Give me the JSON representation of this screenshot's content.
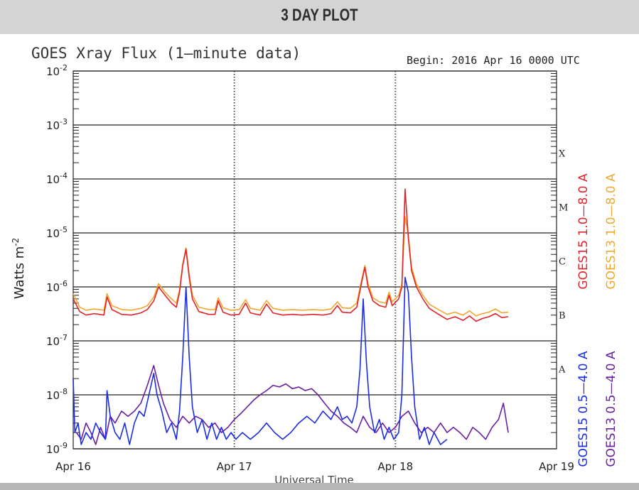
{
  "header": {
    "title": "3 DAY PLOT"
  },
  "chart_data": {
    "type": "line",
    "title": "GOES Xray Flux (1—minute data)",
    "subtitle": "Begin:  2016 Apr 16 0000 UTC",
    "ylabel": "Watts m",
    "ylabel_sup": "-2",
    "xlabel": "Universal Time",
    "y_scale": "log",
    "ylim": [
      1e-09,
      0.01
    ],
    "xlim": [
      0,
      3
    ],
    "y_ticks": [
      {
        "value": 0.01,
        "exp": "-2"
      },
      {
        "value": 0.001,
        "exp": "-3"
      },
      {
        "value": 0.0001,
        "exp": "-4"
      },
      {
        "value": 1e-05,
        "exp": "-5"
      },
      {
        "value": 1e-06,
        "exp": "-6"
      },
      {
        "value": 1e-07,
        "exp": "-7"
      },
      {
        "value": 1e-08,
        "exp": "-8"
      },
      {
        "value": 1e-09,
        "exp": "-9"
      }
    ],
    "y_tick_base": "10",
    "x_ticks": [
      {
        "value": 0,
        "label": "Apr 16"
      },
      {
        "value": 1,
        "label": "Apr 17"
      },
      {
        "value": 2,
        "label": "Apr 18"
      },
      {
        "value": 3,
        "label": "Apr 19"
      }
    ],
    "flare_classes": [
      {
        "label": "X",
        "value": 0.0003
      },
      {
        "label": "M",
        "value": 3e-05
      },
      {
        "label": "C",
        "value": 3e-06
      },
      {
        "label": "B",
        "value": 3e-07
      },
      {
        "label": "A",
        "value": 3e-08
      }
    ],
    "grid": true,
    "series": [
      {
        "name": "GOES15 1.0—8.0 A",
        "color": "#e0242b",
        "points": [
          [
            0.0,
            6e-07
          ],
          [
            0.04,
            3.5e-07
          ],
          [
            0.08,
            3e-07
          ],
          [
            0.13,
            3.2e-07
          ],
          [
            0.19,
            3e-07
          ],
          [
            0.21,
            6.5e-07
          ],
          [
            0.24,
            3.8e-07
          ],
          [
            0.3,
            3.1e-07
          ],
          [
            0.36,
            3e-07
          ],
          [
            0.42,
            3.3e-07
          ],
          [
            0.46,
            3.8e-07
          ],
          [
            0.5,
            5.5e-07
          ],
          [
            0.53,
            1e-06
          ],
          [
            0.57,
            7e-07
          ],
          [
            0.61,
            5e-07
          ],
          [
            0.64,
            4.2e-07
          ],
          [
            0.66,
            8e-07
          ],
          [
            0.68,
            2.5e-06
          ],
          [
            0.7,
            5e-06
          ],
          [
            0.72,
            1.5e-06
          ],
          [
            0.74,
            6e-07
          ],
          [
            0.78,
            3.5e-07
          ],
          [
            0.84,
            3.1e-07
          ],
          [
            0.88,
            3.1e-07
          ],
          [
            0.9,
            5.5e-07
          ],
          [
            0.93,
            3.4e-07
          ],
          [
            0.98,
            3e-07
          ],
          [
            1.03,
            3.1e-07
          ],
          [
            1.07,
            5e-07
          ],
          [
            1.1,
            3.3e-07
          ],
          [
            1.16,
            3e-07
          ],
          [
            1.2,
            4.8e-07
          ],
          [
            1.24,
            3.3e-07
          ],
          [
            1.3,
            3e-07
          ],
          [
            1.36,
            3.1e-07
          ],
          [
            1.42,
            3e-07
          ],
          [
            1.49,
            3.1e-07
          ],
          [
            1.55,
            3e-07
          ],
          [
            1.6,
            3.2e-07
          ],
          [
            1.64,
            4.5e-07
          ],
          [
            1.67,
            3.4e-07
          ],
          [
            1.72,
            3.3e-07
          ],
          [
            1.76,
            4.2e-07
          ],
          [
            1.79,
            1.2e-06
          ],
          [
            1.81,
            2.3e-06
          ],
          [
            1.83,
            1e-06
          ],
          [
            1.86,
            5.5e-07
          ],
          [
            1.9,
            4.5e-07
          ],
          [
            1.94,
            4.2e-07
          ],
          [
            1.96,
            7e-07
          ],
          [
            1.98,
            4.5e-07
          ],
          [
            2.02,
            6e-07
          ],
          [
            2.04,
            1e-06
          ],
          [
            2.06,
            6.5e-05
          ],
          [
            2.08,
            8e-06
          ],
          [
            2.1,
            2e-06
          ],
          [
            2.13,
            1e-06
          ],
          [
            2.17,
            6e-07
          ],
          [
            2.21,
            4e-07
          ],
          [
            2.26,
            3.2e-07
          ],
          [
            2.32,
            2.5e-07
          ],
          [
            2.37,
            2.8e-07
          ],
          [
            2.42,
            2.4e-07
          ],
          [
            2.46,
            2.9e-07
          ],
          [
            2.5,
            2.3e-07
          ],
          [
            2.54,
            2.6e-07
          ],
          [
            2.58,
            2.8e-07
          ],
          [
            2.62,
            3.2e-07
          ],
          [
            2.66,
            2.7e-07
          ],
          [
            2.7,
            2.8e-07
          ]
        ]
      },
      {
        "name": "GOES13 1.0—8.0 A",
        "color": "#f0a830",
        "points": [
          [
            0.0,
            7.5e-07
          ],
          [
            0.04,
            4.2e-07
          ],
          [
            0.08,
            3.7e-07
          ],
          [
            0.13,
            3.9e-07
          ],
          [
            0.19,
            3.7e-07
          ],
          [
            0.21,
            7.5e-07
          ],
          [
            0.24,
            4.5e-07
          ],
          [
            0.3,
            3.8e-07
          ],
          [
            0.36,
            3.7e-07
          ],
          [
            0.42,
            4e-07
          ],
          [
            0.46,
            4.5e-07
          ],
          [
            0.5,
            6.5e-07
          ],
          [
            0.53,
            1.15e-06
          ],
          [
            0.57,
            8e-07
          ],
          [
            0.61,
            6e-07
          ],
          [
            0.64,
            5e-07
          ],
          [
            0.66,
            9e-07
          ],
          [
            0.68,
            2.7e-06
          ],
          [
            0.7,
            5.3e-06
          ],
          [
            0.72,
            1.7e-06
          ],
          [
            0.74,
            7e-07
          ],
          [
            0.78,
            4.2e-07
          ],
          [
            0.84,
            3.8e-07
          ],
          [
            0.88,
            3.8e-07
          ],
          [
            0.9,
            6.3e-07
          ],
          [
            0.93,
            4.1e-07
          ],
          [
            0.98,
            3.7e-07
          ],
          [
            1.03,
            3.8e-07
          ],
          [
            1.07,
            5.8e-07
          ],
          [
            1.1,
            4e-07
          ],
          [
            1.16,
            3.7e-07
          ],
          [
            1.2,
            5.6e-07
          ],
          [
            1.24,
            4e-07
          ],
          [
            1.3,
            3.7e-07
          ],
          [
            1.36,
            3.8e-07
          ],
          [
            1.42,
            3.7e-07
          ],
          [
            1.49,
            3.8e-07
          ],
          [
            1.55,
            3.7e-07
          ],
          [
            1.6,
            3.9e-07
          ],
          [
            1.64,
            5.3e-07
          ],
          [
            1.67,
            4.1e-07
          ],
          [
            1.72,
            4e-07
          ],
          [
            1.76,
            5e-07
          ],
          [
            1.79,
            1.35e-06
          ],
          [
            1.81,
            2.5e-06
          ],
          [
            1.83,
            1.15e-06
          ],
          [
            1.86,
            6.3e-07
          ],
          [
            1.9,
            5.3e-07
          ],
          [
            1.94,
            5e-07
          ],
          [
            1.96,
            8e-07
          ],
          [
            1.98,
            5.3e-07
          ],
          [
            2.02,
            7e-07
          ],
          [
            2.04,
            1.15e-06
          ],
          [
            2.06,
            2e-05
          ],
          [
            2.08,
            9e-06
          ],
          [
            2.1,
            2.3e-06
          ],
          [
            2.13,
            1.15e-06
          ],
          [
            2.17,
            7e-07
          ],
          [
            2.21,
            4.8e-07
          ],
          [
            2.26,
            3.9e-07
          ],
          [
            2.32,
            3.1e-07
          ],
          [
            2.37,
            3.4e-07
          ],
          [
            2.42,
            3e-07
          ],
          [
            2.46,
            3.6e-07
          ],
          [
            2.5,
            2.9e-07
          ],
          [
            2.54,
            3.2e-07
          ],
          [
            2.58,
            3.4e-07
          ],
          [
            2.62,
            3.9e-07
          ],
          [
            2.66,
            3.3e-07
          ],
          [
            2.7,
            3.4e-07
          ]
        ]
      },
      {
        "name": "GOES15 0.5—4.0 A",
        "color": "#1a2ee0",
        "points": [
          [
            0.0,
            2e-08
          ],
          [
            0.01,
            2e-09
          ],
          [
            0.03,
            3e-09
          ],
          [
            0.05,
            1.2e-09
          ],
          [
            0.08,
            2e-09
          ],
          [
            0.11,
            1.5e-09
          ],
          [
            0.14,
            3e-09
          ],
          [
            0.17,
            2e-09
          ],
          [
            0.2,
            1.5e-09
          ],
          [
            0.21,
            1.2e-08
          ],
          [
            0.23,
            4e-09
          ],
          [
            0.26,
            2e-09
          ],
          [
            0.29,
            1.5e-09
          ],
          [
            0.32,
            3e-09
          ],
          [
            0.35,
            1.2e-09
          ],
          [
            0.38,
            3e-09
          ],
          [
            0.41,
            5e-09
          ],
          [
            0.44,
            4e-09
          ],
          [
            0.47,
            1e-08
          ],
          [
            0.5,
            2.5e-08
          ],
          [
            0.52,
            1e-08
          ],
          [
            0.55,
            5e-09
          ],
          [
            0.58,
            2e-09
          ],
          [
            0.61,
            3e-09
          ],
          [
            0.64,
            1.5e-09
          ],
          [
            0.66,
            5e-09
          ],
          [
            0.68,
            5e-08
          ],
          [
            0.7,
            1e-06
          ],
          [
            0.72,
            5e-08
          ],
          [
            0.74,
            6e-09
          ],
          [
            0.77,
            2e-09
          ],
          [
            0.8,
            3.5e-09
          ],
          [
            0.83,
            1.5e-09
          ],
          [
            0.86,
            3e-09
          ],
          [
            0.89,
            1.5e-09
          ],
          [
            0.92,
            2.5e-09
          ],
          [
            0.95,
            1.5e-09
          ],
          [
            0.98,
            2e-09
          ],
          [
            1.01,
            1.5e-09
          ],
          [
            1.05,
            2e-09
          ],
          [
            1.1,
            1.5e-09
          ],
          [
            1.15,
            2e-09
          ],
          [
            1.2,
            3e-09
          ],
          [
            1.25,
            2e-09
          ],
          [
            1.3,
            1.5e-09
          ],
          [
            1.35,
            2e-09
          ],
          [
            1.4,
            3e-09
          ],
          [
            1.45,
            4e-09
          ],
          [
            1.5,
            3e-09
          ],
          [
            1.55,
            5e-09
          ],
          [
            1.6,
            3.5e-09
          ],
          [
            1.64,
            6e-09
          ],
          [
            1.67,
            3.5e-09
          ],
          [
            1.7,
            4e-09
          ],
          [
            1.73,
            3e-09
          ],
          [
            1.76,
            6e-09
          ],
          [
            1.78,
            3e-08
          ],
          [
            1.8,
            6e-07
          ],
          [
            1.82,
            4e-08
          ],
          [
            1.84,
            6e-09
          ],
          [
            1.87,
            2e-09
          ],
          [
            1.9,
            3.5e-09
          ],
          [
            1.93,
            1.5e-09
          ],
          [
            1.96,
            2.5e-09
          ],
          [
            1.99,
            1.5e-09
          ],
          [
            2.02,
            2e-09
          ],
          [
            2.04,
            1e-08
          ],
          [
            2.06,
            1.5e-06
          ],
          [
            2.08,
            8e-07
          ],
          [
            2.1,
            5e-08
          ],
          [
            2.12,
            6e-09
          ],
          [
            2.15,
            1.5e-09
          ],
          [
            2.18,
            2.5e-09
          ],
          [
            2.21,
            1.2e-09
          ],
          [
            2.24,
            2e-09
          ],
          [
            2.28,
            1.2e-09
          ],
          [
            2.32,
            1.5e-09
          ]
        ]
      },
      {
        "name": "GOES13 0.5—4.0 A",
        "color": "#6a1fa0",
        "points": [
          [
            0.02,
            2e-09
          ],
          [
            0.05,
            1.5e-09
          ],
          [
            0.08,
            3e-09
          ],
          [
            0.11,
            2e-09
          ],
          [
            0.14,
            1.2e-09
          ],
          [
            0.17,
            2.5e-09
          ],
          [
            0.2,
            1.5e-09
          ],
          [
            0.23,
            4e-09
          ],
          [
            0.26,
            3e-09
          ],
          [
            0.3,
            5e-09
          ],
          [
            0.34,
            4e-09
          ],
          [
            0.38,
            5e-09
          ],
          [
            0.42,
            7e-09
          ],
          [
            0.46,
            1.5e-08
          ],
          [
            0.5,
            3.5e-08
          ],
          [
            0.53,
            1.5e-08
          ],
          [
            0.56,
            7e-09
          ],
          [
            0.6,
            3.5e-09
          ],
          [
            0.64,
            2.5e-09
          ],
          [
            0.68,
            4e-09
          ],
          [
            0.72,
            3e-09
          ],
          [
            0.76,
            4e-09
          ],
          [
            0.8,
            3.5e-09
          ],
          [
            0.84,
            2.5e-09
          ],
          [
            0.88,
            3e-09
          ],
          [
            0.92,
            2e-09
          ],
          [
            0.96,
            2.5e-09
          ],
          [
            1.0,
            3.5e-09
          ],
          [
            1.04,
            4.5e-09
          ],
          [
            1.08,
            6e-09
          ],
          [
            1.12,
            8e-09
          ],
          [
            1.16,
            1e-08
          ],
          [
            1.2,
            1.2e-08
          ],
          [
            1.24,
            1.5e-08
          ],
          [
            1.28,
            1.4e-08
          ],
          [
            1.32,
            1.6e-08
          ],
          [
            1.36,
            1.3e-08
          ],
          [
            1.4,
            1.4e-08
          ],
          [
            1.44,
            1.2e-08
          ],
          [
            1.48,
            1.3e-08
          ],
          [
            1.52,
            1e-08
          ],
          [
            1.56,
            7e-09
          ],
          [
            1.6,
            5e-09
          ],
          [
            1.64,
            4e-09
          ],
          [
            1.68,
            3e-09
          ],
          [
            1.72,
            2.5e-09
          ],
          [
            1.76,
            2e-09
          ],
          [
            1.8,
            4e-09
          ],
          [
            1.84,
            2.5e-09
          ],
          [
            1.88,
            2e-09
          ],
          [
            1.92,
            3e-09
          ],
          [
            1.96,
            2e-09
          ],
          [
            2.0,
            2.5e-09
          ],
          [
            2.04,
            4e-09
          ],
          [
            2.08,
            5e-09
          ],
          [
            2.12,
            3e-09
          ],
          [
            2.16,
            2e-09
          ],
          [
            2.2,
            2.5e-09
          ],
          [
            2.24,
            2e-09
          ],
          [
            2.28,
            3e-09
          ],
          [
            2.32,
            2e-09
          ],
          [
            2.36,
            2.5e-09
          ],
          [
            2.4,
            2e-09
          ],
          [
            2.44,
            1.5e-09
          ],
          [
            2.48,
            2.5e-09
          ],
          [
            2.52,
            2e-09
          ],
          [
            2.56,
            1.5e-09
          ],
          [
            2.6,
            2.5e-09
          ],
          [
            2.64,
            3.5e-09
          ],
          [
            2.67,
            7e-09
          ],
          [
            2.7,
            2e-09
          ]
        ]
      }
    ]
  }
}
